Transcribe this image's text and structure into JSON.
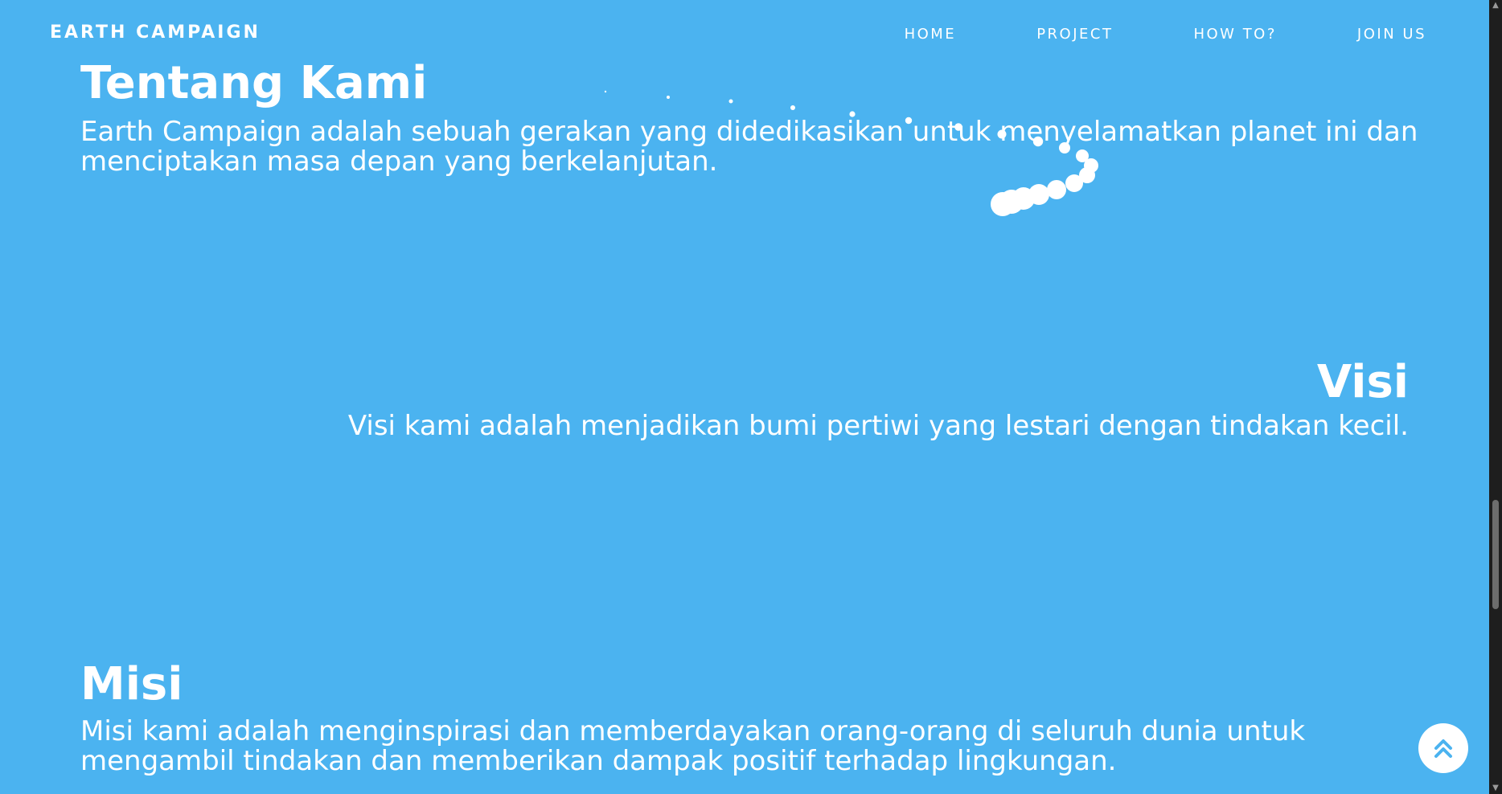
{
  "navbar": {
    "brand": "EARTH CAMPAIGN",
    "links": [
      "HOME",
      "PROJECT",
      "HOW TO?",
      "JOIN US"
    ]
  },
  "about": {
    "title": "Tentang Kami",
    "text": "Earth Campaign adalah sebuah gerakan yang didedikasikan untuk menyelamatkan planet ini dan menciptakan masa depan yang berkelanjutan."
  },
  "visi": {
    "title": "Visi",
    "text": "Visi kami adalah menjadikan bumi pertiwi yang lestari dengan tindakan kecil."
  },
  "misi": {
    "title": "Misi",
    "text": "Misi kami adalah menginspirasi dan memberdayakan orang-orang di seluruh dunia untuk mengambil tindakan dan memberikan dampak positif terhadap lingkungan."
  },
  "icons": {
    "back_to_top": "double-chevron-up-icon",
    "scroll_up": "scroll-up-arrow-icon",
    "scroll_down": "scroll-down-arrow-icon"
  },
  "colors": {
    "background": "#4bb3f0",
    "text": "#ffffff",
    "scrollbar_track": "#1e1e1e",
    "scrollbar_thumb": "#6d6d6d",
    "button_icon": "#4bb3f0"
  }
}
